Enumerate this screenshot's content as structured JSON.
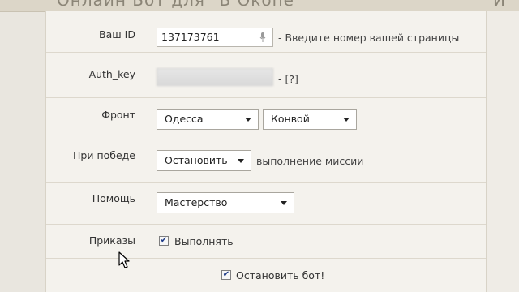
{
  "header": {
    "title": "Онлайн Бот для \"В Окопе\"",
    "right_fragment": "И"
  },
  "fields": {
    "vk_id": {
      "label": "Ваш ID",
      "value": "137173761",
      "hint": "- Введите номер вашей страницы"
    },
    "auth_key": {
      "label": "Auth_key",
      "hint_prefix": "- ",
      "help_link": "[?]"
    },
    "front": {
      "label": "Фронт",
      "city": "Одесса",
      "unit": "Конвой"
    },
    "on_win": {
      "label": "При победе",
      "action": "Остановить",
      "hint": "выполнение миссии"
    },
    "help": {
      "label": "Помощь",
      "value": "Мастерство"
    },
    "orders": {
      "label": "Приказы",
      "checkbox_label": "Выполнять",
      "checked": true
    },
    "stop_bot": {
      "checkbox_label": "Остановить бот!",
      "checked": true
    }
  },
  "icons": {
    "mic": "microphone-icon",
    "check": "checkmark-icon",
    "cursor": "mouse-pointer-icon"
  },
  "colors": {
    "background": "#e9e6df",
    "panel": "#f4f2ed",
    "border": "#ddd8cd",
    "check": "#1f3c88"
  }
}
